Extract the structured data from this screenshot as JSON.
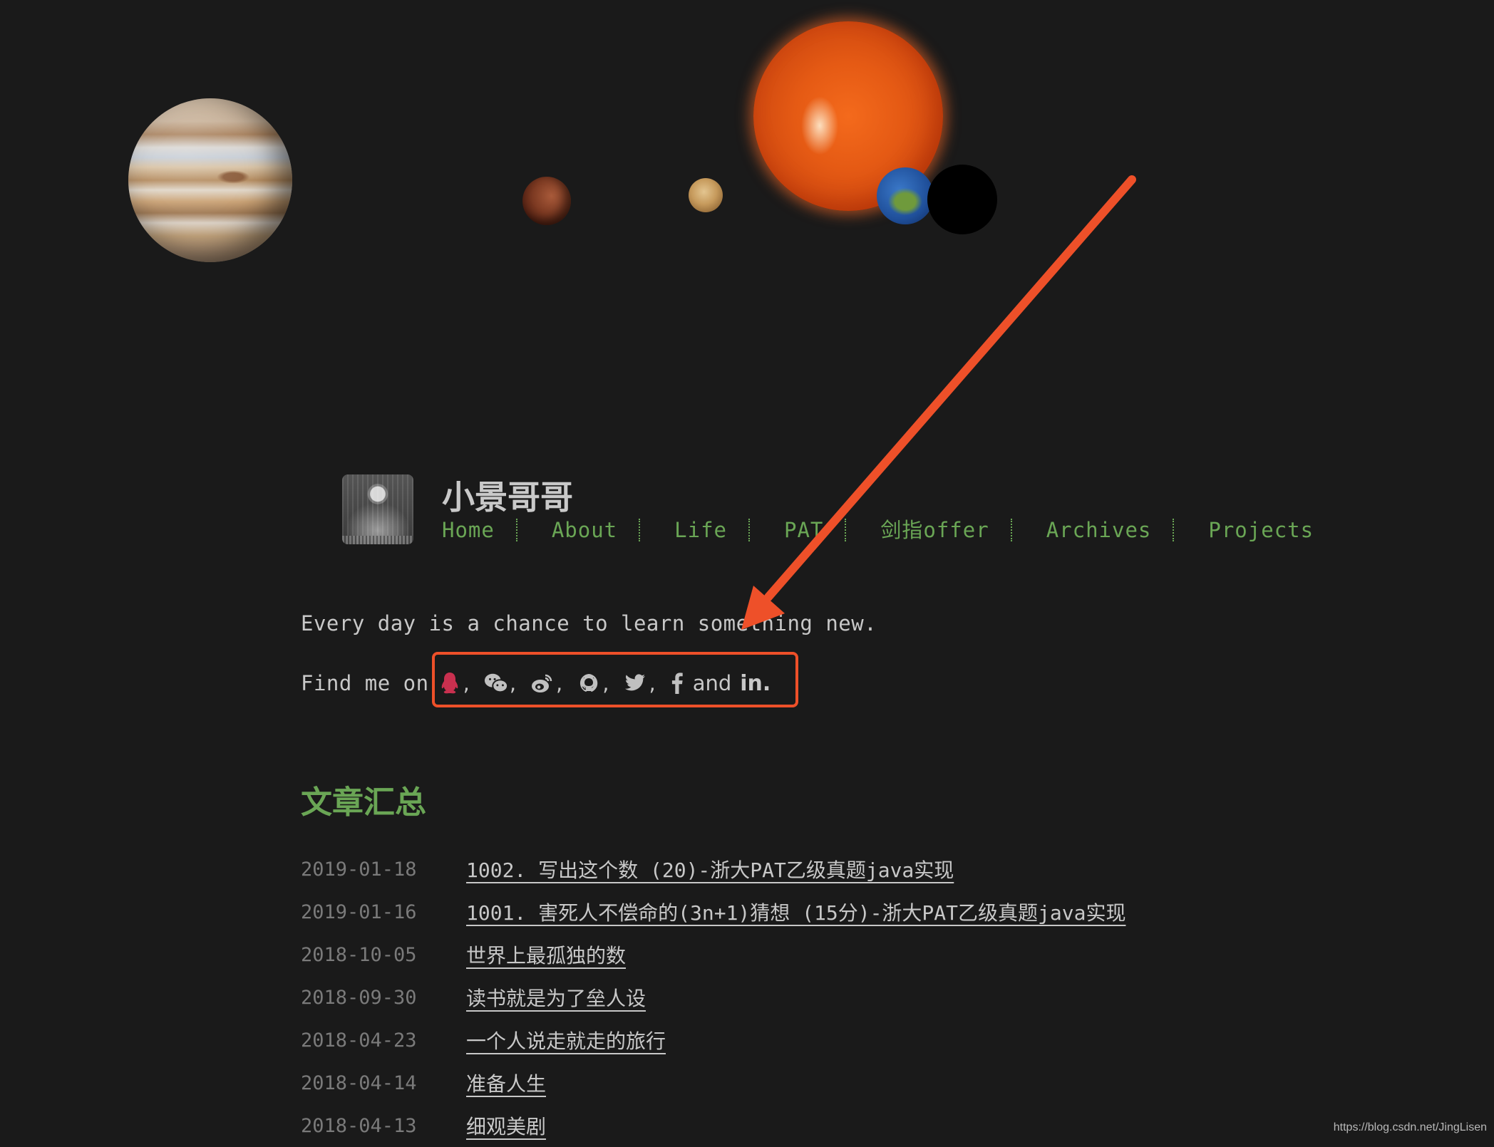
{
  "header": {
    "site_title": "小景哥哥",
    "nav": [
      {
        "label": "Home"
      },
      {
        "label": "About"
      },
      {
        "label": "Life"
      },
      {
        "label": "PAT"
      },
      {
        "label": "剑指offer"
      },
      {
        "label": "Archives"
      },
      {
        "label": "Projects"
      }
    ]
  },
  "intro": {
    "tagline": "Every day is a chance to learn something new.",
    "find_me_label": "Find me on",
    "social": [
      {
        "icon": "qq-icon",
        "color": "#c9304f"
      },
      {
        "icon": "wechat-icon",
        "color": "#c0c0c0"
      },
      {
        "icon": "weibo-icon",
        "color": "#c0c0c0"
      },
      {
        "icon": "github-icon",
        "color": "#c0c0c0"
      },
      {
        "icon": "twitter-icon",
        "color": "#c0c0c0"
      },
      {
        "icon": "facebook-icon",
        "color": "#c0c0c0"
      },
      {
        "icon": "linkedin-icon",
        "color": "#c0c0c0"
      }
    ],
    "separator": ",",
    "and_text": "and",
    "linkedin_text": "in",
    "end_punct": "."
  },
  "posts_section": {
    "heading": "文章汇总",
    "posts": [
      {
        "date": "2019-01-18",
        "title": "1002. 写出这个数 (20)-浙大PAT乙级真题java实现"
      },
      {
        "date": "2019-01-16",
        "title": "1001. 害死人不偿命的(3n+1)猜想 (15分)-浙大PAT乙级真题java实现"
      },
      {
        "date": "2018-10-05",
        "title": "世界上最孤独的数"
      },
      {
        "date": "2018-09-30",
        "title": "读书就是为了垒人设"
      },
      {
        "date": "2018-04-23",
        "title": "一个人说走就走的旅行"
      },
      {
        "date": "2018-04-14",
        "title": "准备人生"
      },
      {
        "date": "2018-04-13",
        "title": "细观美剧"
      }
    ]
  },
  "annotation": {
    "color": "#ee5029"
  },
  "colors": {
    "background": "#1a1a1a",
    "accent_green": "#6aa655",
    "text": "#c8c8c8",
    "date_text": "#7a7a7a"
  },
  "watermark": "https://blog.csdn.net/JingLisen"
}
